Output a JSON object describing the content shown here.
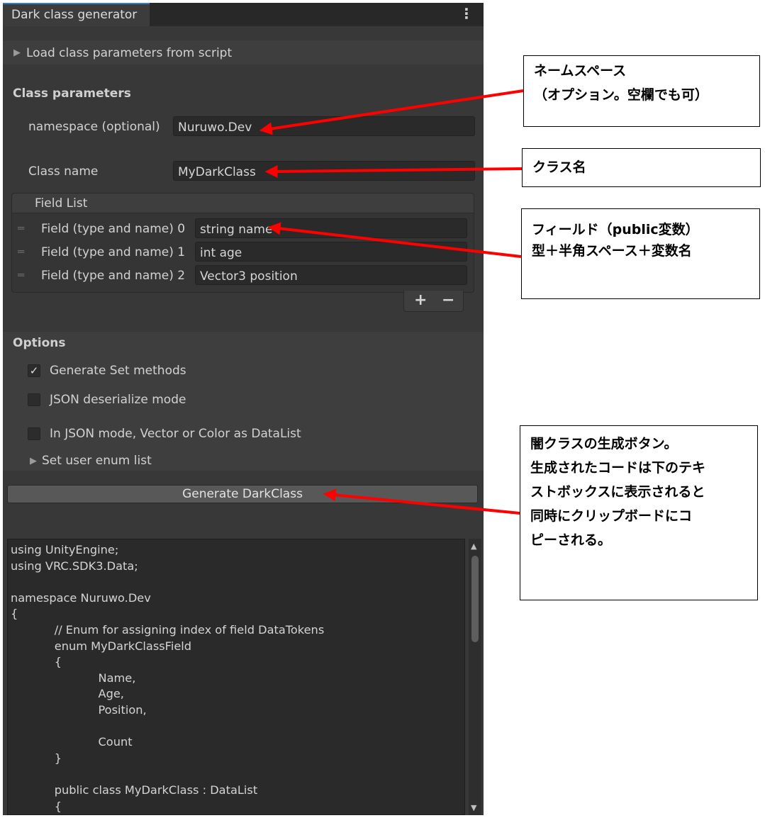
{
  "window": {
    "tab_title": "Dark class generator",
    "menu_icon": "kebab-menu-icon"
  },
  "load_section": {
    "label": "Load class parameters from script",
    "expanded": false
  },
  "class_params": {
    "header": "Class parameters",
    "namespace_label": "namespace (optional)",
    "namespace_value": "Nuruwo.Dev",
    "classname_label": "Class name",
    "classname_value": "MyDarkClass"
  },
  "field_list": {
    "header": "Field List",
    "items": [
      {
        "label": "Field (type and name) 0",
        "value": "string name"
      },
      {
        "label": "Field (type and name) 1",
        "value": "int age"
      },
      {
        "label": "Field (type and name) 2",
        "value": "Vector3 position"
      }
    ],
    "add_label": "+",
    "remove_label": "−"
  },
  "options": {
    "header": "Options",
    "items": [
      {
        "label": "Generate Set methods",
        "checked": true
      },
      {
        "label": "JSON deserialize mode",
        "checked": false
      },
      {
        "label": "In JSON mode, Vector or Color as DataList",
        "checked": false
      }
    ],
    "enum_foldout": "Set user enum list"
  },
  "generate_button": "Generate DarkClass",
  "code_output": [
    "using UnityEngine;",
    "using VRC.SDK3.Data;",
    "",
    "namespace Nuruwo.Dev",
    "{",
    "            // Enum for assigning index of field DataTokens",
    "            enum MyDarkClassField",
    "            {",
    "                        Name,",
    "                        Age,",
    "                        Position,",
    "",
    "                        Count",
    "            }",
    "",
    "            public class MyDarkClass : DataList",
    "            {"
  ],
  "annotations": {
    "namespace_note": [
      "ネームスペース",
      "（オプション。空欄でも可）"
    ],
    "classname_note": [
      "クラス名"
    ],
    "field_note": [
      "フィールド（public変数）",
      "",
      "型＋半角スペース＋変数名"
    ],
    "generate_note": [
      "闇クラスの生成ボタン。",
      "",
      "生成されたコードは下のテキ",
      "ストボックスに表示されると",
      "同時にクリップボードにコ",
      "ピーされる。"
    ]
  },
  "colors": {
    "panel_bg": "#383838",
    "arrow": "#ff0000",
    "accent": "#3a79bb"
  }
}
